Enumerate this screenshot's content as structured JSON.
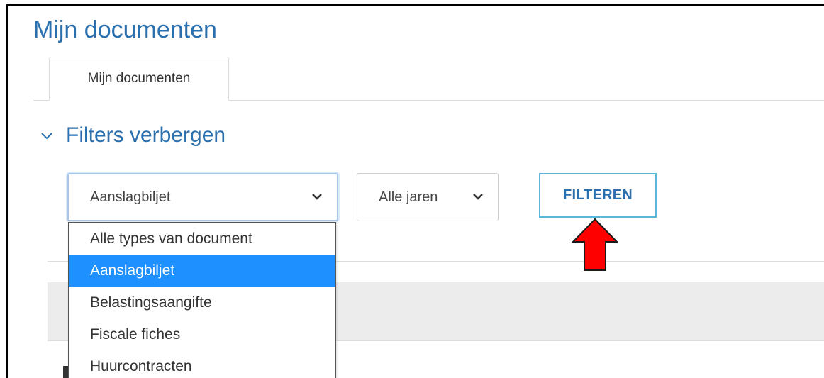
{
  "page": {
    "title": "Mijn documenten"
  },
  "tabs": [
    {
      "label": "Mijn documenten",
      "active": true
    }
  ],
  "filters": {
    "toggle_label": "Filters verbergen",
    "document_type": {
      "selected": "Aanslagbiljet",
      "options": [
        "Alle types van document",
        "Aanslagbiljet",
        "Belastingsaangifte",
        "Fiscale fiches",
        "Huurcontracten"
      ]
    },
    "year": {
      "selected": "Alle jaren"
    },
    "filter_button": "FILTEREN"
  },
  "colors": {
    "title_blue": "#2a6fae",
    "button_border": "#5ab7d8",
    "selected_option": "#1e90ff",
    "annotation_arrow": "#ff0000"
  }
}
